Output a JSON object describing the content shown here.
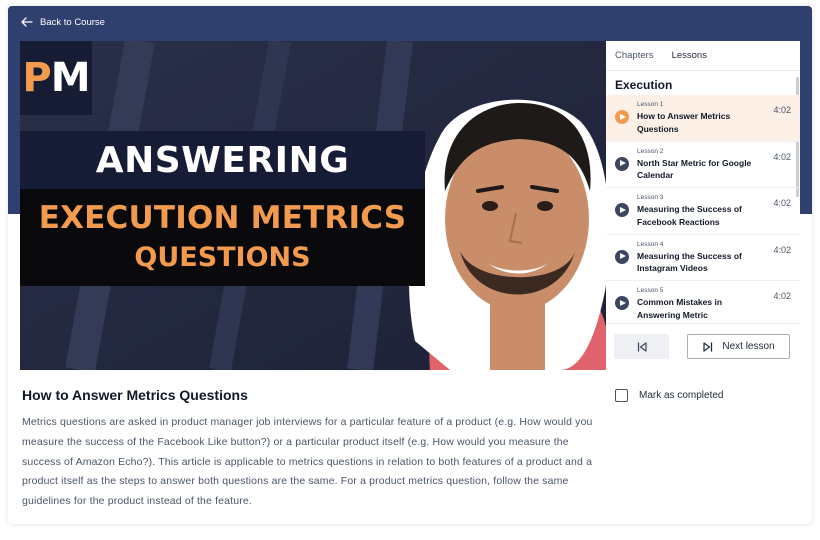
{
  "header": {
    "back_label": "Back to Course"
  },
  "video": {
    "logo_p": "P",
    "logo_m": "M",
    "line1": "ANSWERING",
    "line2": "EXECUTION METRICS",
    "line3": "QUESTIONS"
  },
  "sidebar": {
    "tabs": [
      {
        "label": "Chapters"
      },
      {
        "label": "Lessons"
      }
    ],
    "chapter": "Execution",
    "lessons": [
      {
        "number": "Lesson 1",
        "title": "How to Answer Metrics Questions",
        "duration": "4:02",
        "current": true
      },
      {
        "number": "Lesson 2",
        "title": "North Star Metric for Google Calendar",
        "duration": "4:02"
      },
      {
        "number": "Lesson 3",
        "title": "Measuring the Success of Facebook Reactions",
        "duration": "4:02"
      },
      {
        "number": "Lesson 4",
        "title": "Measuring the Success of Instagram Videos",
        "duration": "4:02"
      },
      {
        "number": "Lesson 5",
        "title": "Common Mistakes in Answering Metric",
        "duration": "4:02"
      }
    ],
    "next_label": "Next lesson"
  },
  "content": {
    "title": "How to Answer Metrics Questions",
    "mark_label": "Mark as completed",
    "description": "Metrics questions are asked in product manager job interviews for a particular feature of a product (e.g. How would you measure the success of the Facebook Like button?) or a particular product itself (e.g. How would you measure the success of Amazon Echo?). This article is applicable to metrics questions in relation to both features of a product and a product itself as the steps to answer both questions are the same. For a product metrics question, follow the same guidelines for the product instead of the feature."
  },
  "colors": {
    "header": "#2f3f6e",
    "accent": "#f29a4e",
    "current_lesson_bg": "#fdf0e6"
  }
}
